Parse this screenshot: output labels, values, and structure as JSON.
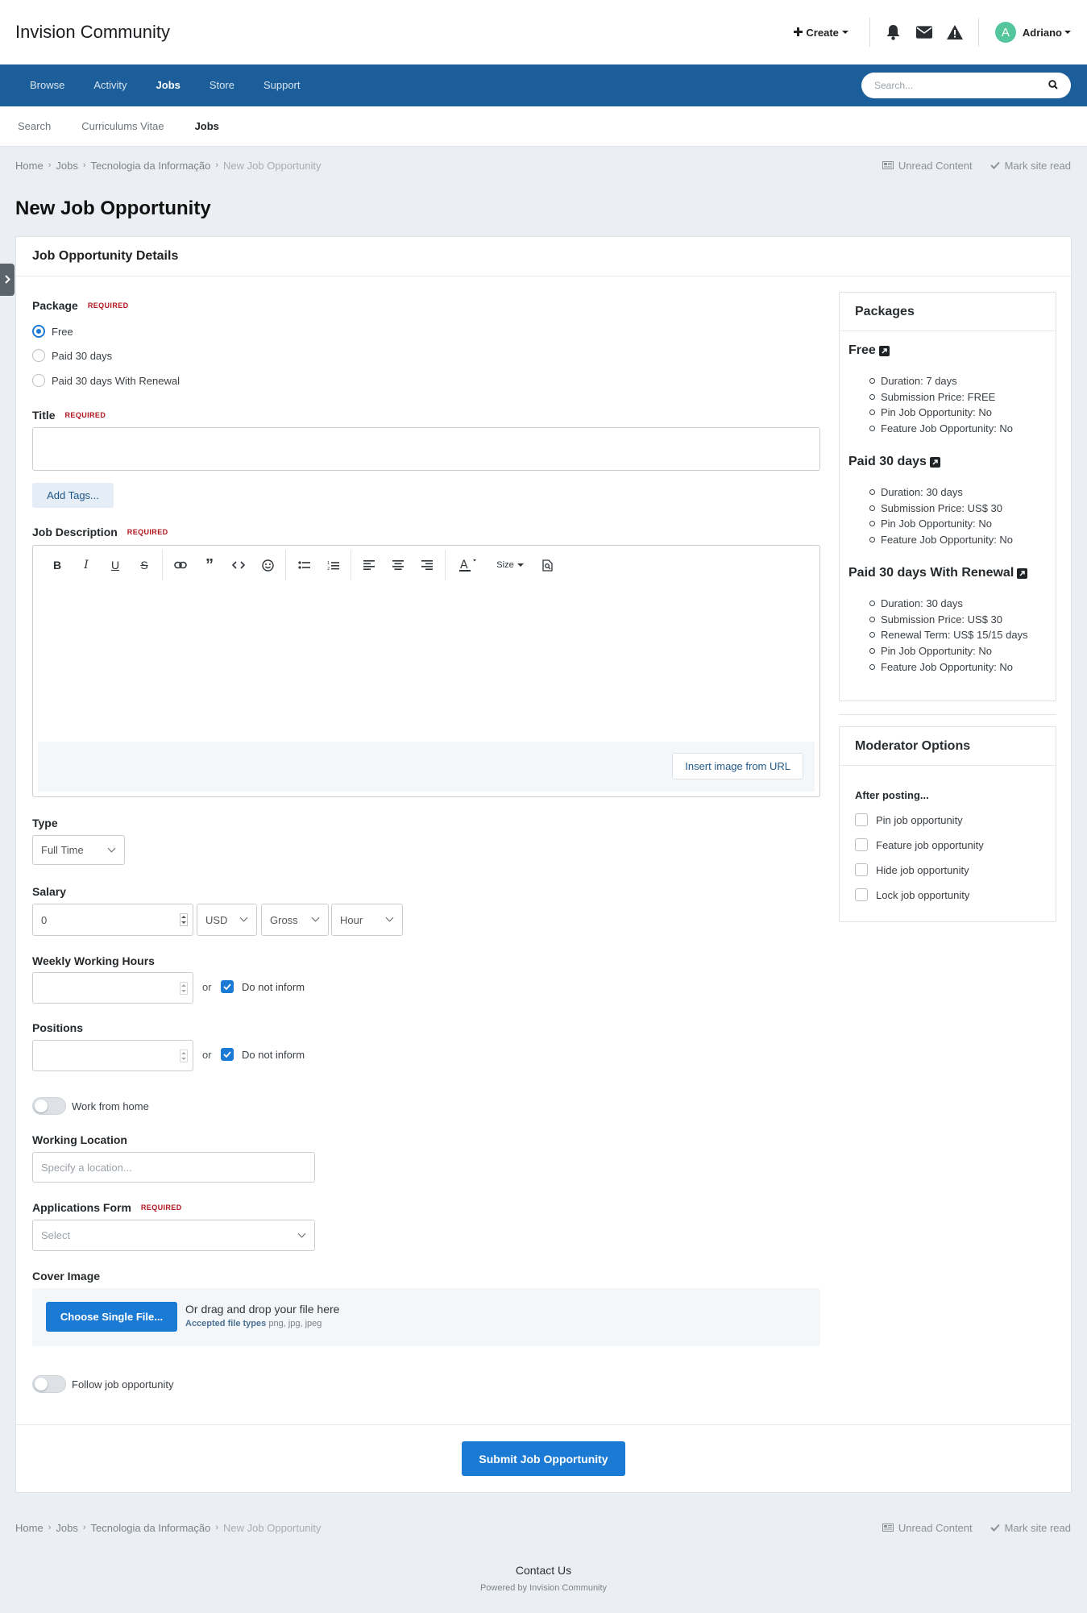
{
  "header": {
    "brand": "Invision Community",
    "create_label": "Create",
    "username": "Adriano",
    "avatar_letter": "A"
  },
  "nav": {
    "items": [
      {
        "label": "Browse"
      },
      {
        "label": "Activity"
      },
      {
        "label": "Jobs"
      },
      {
        "label": "Store"
      },
      {
        "label": "Support"
      }
    ],
    "search_placeholder": "Search..."
  },
  "subnav": {
    "items": [
      {
        "label": "Search"
      },
      {
        "label": "Curriculums Vitae"
      },
      {
        "label": "Jobs"
      }
    ]
  },
  "breadcrumb": {
    "items": [
      "Home",
      "Jobs",
      "Tecnologia da Informação"
    ],
    "current": "New Job Opportunity",
    "unread": "Unread Content",
    "mark_read": "Mark site read"
  },
  "page": {
    "title": "New Job Opportunity",
    "card_title": "Job Opportunity Details"
  },
  "form": {
    "required": "REQUIRED",
    "package_label": "Package",
    "package_options": [
      "Free",
      "Paid 30 days",
      "Paid 30 days With Renewal"
    ],
    "title_label": "Title",
    "add_tags": "Add Tags...",
    "description_label": "Job Description",
    "size_label": "Size",
    "insert_image": "Insert image from URL",
    "type_label": "Type",
    "type_value": "Full Time",
    "salary_label": "Salary",
    "salary_value": "0",
    "currency": "USD",
    "salary_kind": "Gross",
    "salary_period": "Hour",
    "weekly_label": "Weekly Working Hours",
    "or": "or",
    "do_not_inform": "Do not inform",
    "positions_label": "Positions",
    "work_from_home": "Work from home",
    "location_label": "Working Location",
    "location_placeholder": "Specify a location...",
    "app_form_label": "Applications Form",
    "app_form_value": "Select",
    "cover_label": "Cover Image",
    "choose_file": "Choose Single File...",
    "drag_text": "Or drag and drop your file here",
    "accepted_label": "Accepted file types",
    "accepted_types": "png, jpg, jpeg",
    "follow": "Follow job opportunity",
    "submit": "Submit Job Opportunity"
  },
  "packages": {
    "title": "Packages",
    "items": [
      {
        "name": "Free",
        "details": [
          "Duration: 7 days",
          "Submission Price: FREE",
          "Pin Job Opportunity: No",
          "Feature Job Opportunity: No"
        ]
      },
      {
        "name": "Paid 30 days",
        "details": [
          "Duration: 30 days",
          "Submission Price: US$ 30",
          "Pin Job Opportunity: No",
          "Feature Job Opportunity: No"
        ]
      },
      {
        "name": "Paid 30 days With Renewal",
        "details": [
          "Duration: 30 days",
          "Submission Price: US$ 30",
          "Renewal Term: US$ 15/15 days",
          "Pin Job Opportunity: No",
          "Feature Job Opportunity: No"
        ]
      }
    ]
  },
  "moderator": {
    "title": "Moderator Options",
    "subtitle": "After posting...",
    "options": [
      "Pin job opportunity",
      "Feature job opportunity",
      "Hide job opportunity",
      "Lock job opportunity"
    ]
  },
  "footer": {
    "contact": "Contact Us",
    "powered": "Powered by Invision Community"
  },
  "colors": {
    "nav_bg": "#1b5e99",
    "accent": "#1b7ad3",
    "required": "#b3151e",
    "avatar": "#55c59d"
  }
}
